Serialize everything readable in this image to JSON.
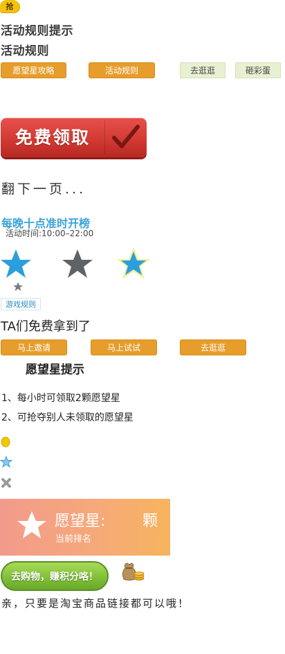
{
  "badge": {
    "label": "抢"
  },
  "headings": {
    "tips": "活动规则提示",
    "rules": "活动规则"
  },
  "top_buttons": [
    {
      "label": "愿望星攻略"
    },
    {
      "label": "活动规则"
    },
    {
      "label": "去逛逛"
    },
    {
      "label": "砸彩蛋"
    }
  ],
  "claim": {
    "label": "免费领取"
  },
  "next_page": {
    "label": "翻下一页..."
  },
  "schedule": {
    "title": "每晚十点准时开榜",
    "time": "活动时间:10:00–22:00"
  },
  "game_rules_link": {
    "label": "游戏规则"
  },
  "ta_section": {
    "title": "TA们免费拿到了",
    "buttons": [
      {
        "label": "马上邀请"
      },
      {
        "label": "马上试试"
      },
      {
        "label": "去逛逛"
      }
    ]
  },
  "wish_tips": {
    "title": "愿望星提示",
    "lines": [
      "1、每小时可领取2颗愿望星",
      "2、可抢夺别人未领取的愿望星"
    ]
  },
  "wish_card": {
    "label": "愿望星:",
    "unit": "颗",
    "rank_label": "当前排名"
  },
  "shop_button": {
    "label": "去购物，赚积分咯！"
  },
  "bottom_note": {
    "label": "亲，只要是淘宝商品链接都可以哦！"
  },
  "colors": {
    "orange": "#e69d2c",
    "pale_green": "#e8f0d2",
    "red": "#d23a33",
    "blue": "#3aa3d9",
    "star_blue": "#2b9fdc",
    "star_gray": "#5f6366",
    "green": "#84c33b"
  },
  "icons": [
    "qiang-badge-icon",
    "checkmark-icon",
    "star-blue-icon",
    "star-gray-icon",
    "star-glow-icon",
    "star-small-icon",
    "coin-icon",
    "star-outline-icon",
    "close-icon",
    "star-white-icon",
    "money-bag-icon"
  ]
}
